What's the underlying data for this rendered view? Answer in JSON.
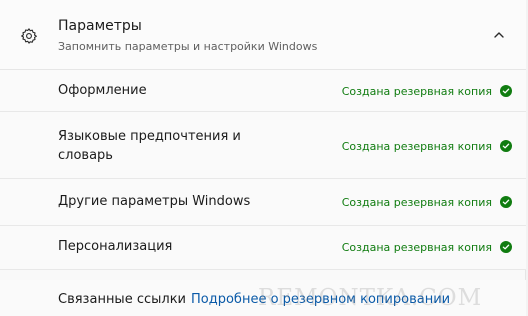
{
  "header": {
    "icon": "gear-icon",
    "title": "Параметры",
    "subtitle": "Запомнить параметры и настройки Windows",
    "toggle_icon": "chevron-up-icon"
  },
  "items": [
    {
      "label": "Оформление",
      "status": "Создана резервная копия",
      "status_icon": "check-circle-icon"
    },
    {
      "label": "Языковые предпочтения и словарь",
      "status": "Создана резервная копия",
      "status_icon": "check-circle-icon"
    },
    {
      "label": "Другие параметры Windows",
      "status": "Создана резервная копия",
      "status_icon": "check-circle-icon"
    },
    {
      "label": "Персонализация",
      "status": "Создана резервная копия",
      "status_icon": "check-circle-icon"
    }
  ],
  "related": {
    "label": "Связанные ссылки",
    "link": "Подробнее о резервном копировании"
  },
  "watermark": "REMONTKA.COM",
  "colors": {
    "status_green": "#107c10",
    "link_blue": "#0a5aa8"
  }
}
